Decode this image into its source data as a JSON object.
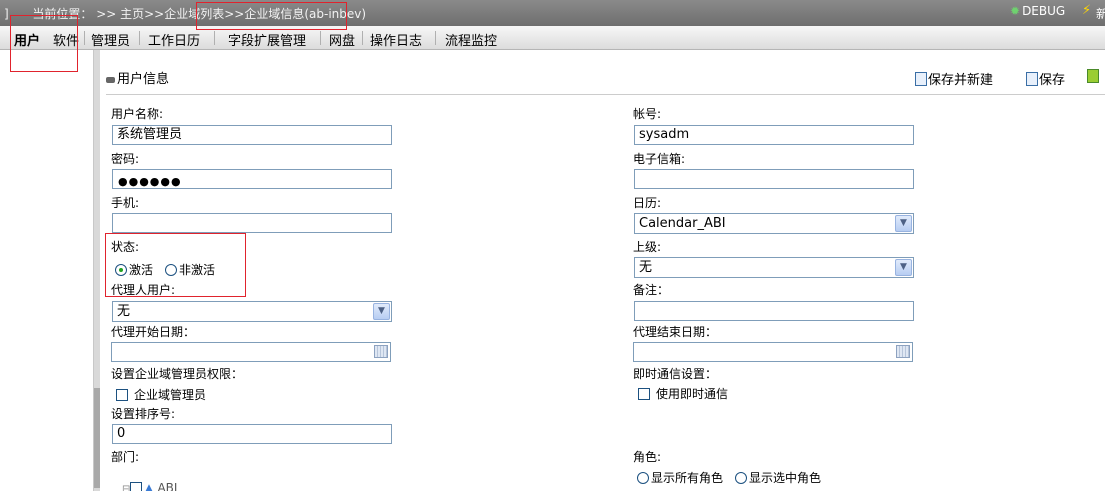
{
  "topbar": {
    "crumb_prefix": "]",
    "location_label": "当前位置：",
    "crumb_home": ">> 主页",
    "crumb_list": ">>企业域列表",
    "crumb_current": ">>企业域信息(ab-inbev)",
    "debug_label": "DEBUG",
    "extra_label": "新"
  },
  "tabs": [
    "用户",
    "软件",
    "管理员",
    "工作日历",
    "字段扩展管理",
    "网盘",
    "操作日志",
    "流程监控"
  ],
  "panel": {
    "title": "用户信息",
    "save_new_label": "保存并新建",
    "save_label": "保存"
  },
  "form": {
    "username_label": "用户名称:",
    "username_value": "系统管理员",
    "account_label": "帐号:",
    "account_value": "sysadm",
    "password_label": "密码:",
    "password_mask": "●●●●●●",
    "email_label": "电子信箱:",
    "email_value": "",
    "mobile_label": "手机:",
    "mobile_value": "",
    "calendar_label": "日历:",
    "calendar_value": "Calendar_ABI",
    "status_label": "状态:",
    "status_active": "激活",
    "status_inactive": "非激活",
    "superior_label": "上级:",
    "superior_value": "无",
    "proxy_user_label": "代理人用户:",
    "proxy_user_value": "无",
    "remark_label": "备注：",
    "remark_value": "",
    "proxy_start_label": "代理开始日期：",
    "proxy_end_label": "代理结束日期：",
    "admin_perm_label": "设置企业域管理员权限：",
    "admin_perm_option": "企业域管理员",
    "im_label": "即时通信设置：",
    "im_option": "使用即时通信",
    "sort_label": "设置排序号:",
    "sort_value": "0",
    "dept_label": "部门:",
    "dept_tree_root": "ABI",
    "role_label": "角色:",
    "role_all": "显示所有角色",
    "role_selected": "显示选中角色"
  }
}
